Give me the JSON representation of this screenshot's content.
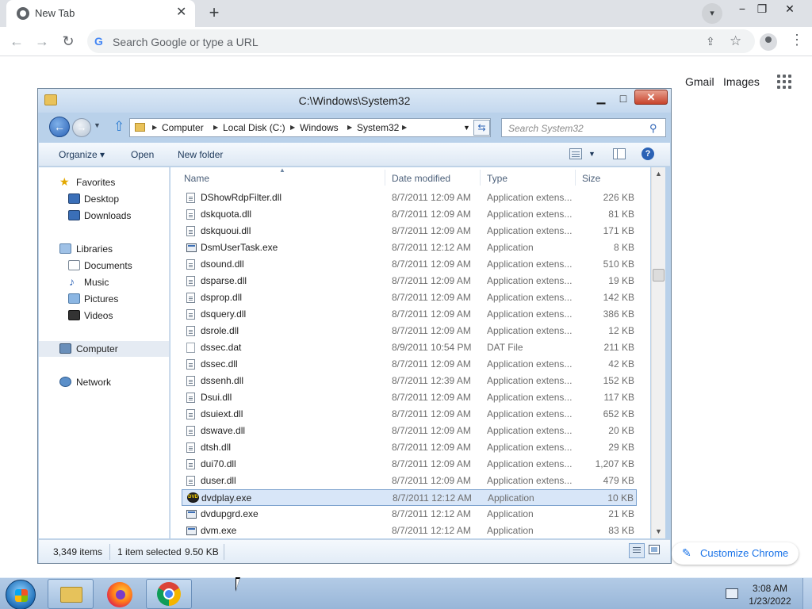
{
  "browser": {
    "tab_title": "New Tab",
    "tab_close": "✕",
    "new_tab": "+",
    "omnibox_placeholder": "Search Google or type a URL",
    "ntp_links": {
      "gmail": "Gmail",
      "images": "Images"
    },
    "customize_label": "Customize Chrome"
  },
  "explorer": {
    "title": "C:\\Windows\\System32",
    "breadcrumbs": [
      "Computer",
      "Local Disk (C:)",
      "Windows",
      "System32"
    ],
    "search_placeholder": "Search System32",
    "commands": {
      "organize": "Organize ▾",
      "open": "Open",
      "new_folder": "New folder"
    },
    "nav": {
      "favorites": "Favorites",
      "desktop": "Desktop",
      "downloads": "Downloads",
      "libraries": "Libraries",
      "documents": "Documents",
      "music": "Music",
      "pictures": "Pictures",
      "videos": "Videos",
      "computer": "Computer",
      "network": "Network"
    },
    "columns": {
      "name": "Name",
      "date": "Date modified",
      "type": "Type",
      "size": "Size"
    },
    "files": [
      {
        "name": "DShowRdpFilter.dll",
        "date": "8/7/2011 12:09 AM",
        "type": "Application extens...",
        "size": "226 KB",
        "icon": "dll"
      },
      {
        "name": "dskquota.dll",
        "date": "8/7/2011 12:09 AM",
        "type": "Application extens...",
        "size": "81 KB",
        "icon": "dll"
      },
      {
        "name": "dskquoui.dll",
        "date": "8/7/2011 12:09 AM",
        "type": "Application extens...",
        "size": "171 KB",
        "icon": "dll"
      },
      {
        "name": "DsmUserTask.exe",
        "date": "8/7/2011 12:12 AM",
        "type": "Application",
        "size": "8 KB",
        "icon": "exe"
      },
      {
        "name": "dsound.dll",
        "date": "8/7/2011 12:09 AM",
        "type": "Application extens...",
        "size": "510 KB",
        "icon": "dll"
      },
      {
        "name": "dsparse.dll",
        "date": "8/7/2011 12:09 AM",
        "type": "Application extens...",
        "size": "19 KB",
        "icon": "dll"
      },
      {
        "name": "dsprop.dll",
        "date": "8/7/2011 12:09 AM",
        "type": "Application extens...",
        "size": "142 KB",
        "icon": "dll"
      },
      {
        "name": "dsquery.dll",
        "date": "8/7/2011 12:09 AM",
        "type": "Application extens...",
        "size": "386 KB",
        "icon": "dll"
      },
      {
        "name": "dsrole.dll",
        "date": "8/7/2011 12:09 AM",
        "type": "Application extens...",
        "size": "12 KB",
        "icon": "dll"
      },
      {
        "name": "dssec.dat",
        "date": "8/9/2011 10:54 PM",
        "type": "DAT File",
        "size": "211 KB",
        "icon": "dat"
      },
      {
        "name": "dssec.dll",
        "date": "8/7/2011 12:09 AM",
        "type": "Application extens...",
        "size": "42 KB",
        "icon": "dll"
      },
      {
        "name": "dssenh.dll",
        "date": "8/7/2011 12:39 AM",
        "type": "Application extens...",
        "size": "152 KB",
        "icon": "dll"
      },
      {
        "name": "Dsui.dll",
        "date": "8/7/2011 12:09 AM",
        "type": "Application extens...",
        "size": "117 KB",
        "icon": "dll"
      },
      {
        "name": "dsuiext.dll",
        "date": "8/7/2011 12:09 AM",
        "type": "Application extens...",
        "size": "652 KB",
        "icon": "dll"
      },
      {
        "name": "dswave.dll",
        "date": "8/7/2011 12:09 AM",
        "type": "Application extens...",
        "size": "20 KB",
        "icon": "dll"
      },
      {
        "name": "dtsh.dll",
        "date": "8/7/2011 12:09 AM",
        "type": "Application extens...",
        "size": "29 KB",
        "icon": "dll"
      },
      {
        "name": "dui70.dll",
        "date": "8/7/2011 12:09 AM",
        "type": "Application extens...",
        "size": "1,207 KB",
        "icon": "dll"
      },
      {
        "name": "duser.dll",
        "date": "8/7/2011 12:09 AM",
        "type": "Application extens...",
        "size": "479 KB",
        "icon": "dll"
      },
      {
        "name": "dvdplay.exe",
        "date": "8/7/2011 12:12 AM",
        "type": "Application",
        "size": "10 KB",
        "icon": "dvd",
        "selected": true
      },
      {
        "name": "dvdupgrd.exe",
        "date": "8/7/2011 12:12 AM",
        "type": "Application",
        "size": "21 KB",
        "icon": "exe"
      },
      {
        "name": "dvm.exe",
        "date": "8/7/2011 12:12 AM",
        "type": "Application",
        "size": "83 KB",
        "icon": "exe"
      }
    ],
    "status": {
      "count": "3,349 items",
      "selected": "1 item selected",
      "size": "9.50 KB"
    }
  },
  "taskbar": {
    "time": "3:08 AM",
    "date": "1/23/2022"
  }
}
